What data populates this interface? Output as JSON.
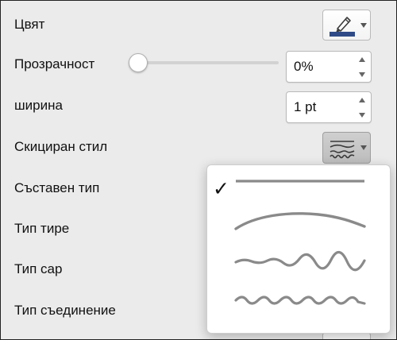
{
  "panel": {
    "color_label": "Цвят",
    "transparency_label": "Прозрачност",
    "transparency_value": "0%",
    "transparency_level": 0,
    "width_label": "ширина",
    "width_value": "1 pt",
    "sketch_style_label": "Скициран стил",
    "compound_type_label": "Съставен тип",
    "dash_type_label": "Тип тире",
    "cap_type_label": "Тип сар",
    "join_type_label": "Тип съединение"
  },
  "colors": {
    "accent_line": "#2f4a86",
    "sketch_line": "#8a8a8a"
  },
  "sketch_menu": {
    "selected_index": 0,
    "check_glyph": "✓",
    "options": [
      "straight-line",
      "curved-line",
      "freehand-line",
      "scribble-line"
    ]
  },
  "icons": [
    "pen-icon",
    "sketch-style-icon",
    "checkmark-icon"
  ]
}
